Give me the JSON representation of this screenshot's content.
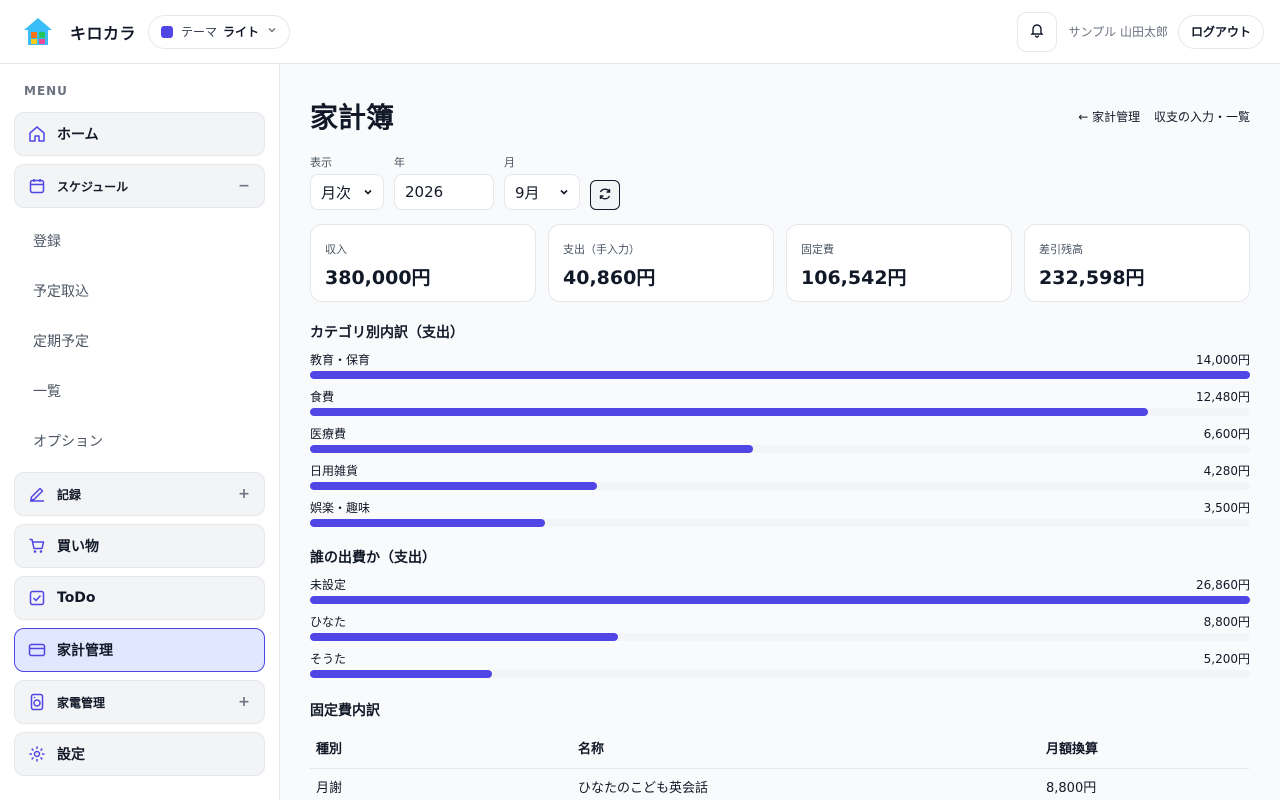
{
  "colors": {
    "accent": "#4f46e5",
    "accent_light": "#e0e7ff"
  },
  "header": {
    "app_name": "キロカラ",
    "theme_label": "テーマ",
    "theme_value": "ライト",
    "user_name": "サンプル 山田太郎",
    "logout_label": "ログアウト"
  },
  "sidebar": {
    "menu_heading": "MENU",
    "home": "ホーム",
    "schedule": "スケジュール",
    "schedule_toggle": "−",
    "schedule_items": [
      "登録",
      "予定取込",
      "定期予定",
      "一覧",
      "オプション"
    ],
    "record": "記録",
    "record_toggle": "+",
    "shopping": "買い物",
    "todo": "ToDo",
    "household": "家計管理",
    "appliance": "家電管理",
    "appliance_toggle": "+",
    "settings": "設定"
  },
  "main": {
    "title": "家計簿",
    "breadcrumb_back": "← 家計管理",
    "breadcrumb_link": "収支の入力・一覧",
    "filters": {
      "view_label": "表示",
      "view_value": "月次",
      "year_label": "年",
      "year_value": "2026",
      "month_label": "月",
      "month_value": "9月"
    },
    "cards": [
      {
        "label": "収入",
        "value": "380,000円"
      },
      {
        "label": "支出（手入力）",
        "value": "40,860円"
      },
      {
        "label": "固定費",
        "value": "106,542円"
      },
      {
        "label": "差引残高",
        "value": "232,598円"
      }
    ],
    "category_title": "カテゴリ別内訳（支出）",
    "categories": [
      {
        "name": "教育・保育",
        "amount": "14,000円",
        "value": 14000
      },
      {
        "name": "食費",
        "amount": "12,480円",
        "value": 12480
      },
      {
        "name": "医療費",
        "amount": "6,600円",
        "value": 6600
      },
      {
        "name": "日用雑貨",
        "amount": "4,280円",
        "value": 4280
      },
      {
        "name": "娯楽・趣味",
        "amount": "3,500円",
        "value": 3500
      }
    ],
    "payer_title": "誰の出費か（支出）",
    "payers": [
      {
        "name": "未設定",
        "amount": "26,860円",
        "value": 26860
      },
      {
        "name": "ひなた",
        "amount": "8,800円",
        "value": 8800
      },
      {
        "name": "そうた",
        "amount": "5,200円",
        "value": 5200
      }
    ],
    "fixed_title": "固定費内訳",
    "fixed_headers": [
      "種別",
      "名称",
      "月額換算"
    ],
    "fixed_rows": [
      [
        "月謝",
        "ひなたのこども英会話",
        "8,800円"
      ]
    ]
  }
}
